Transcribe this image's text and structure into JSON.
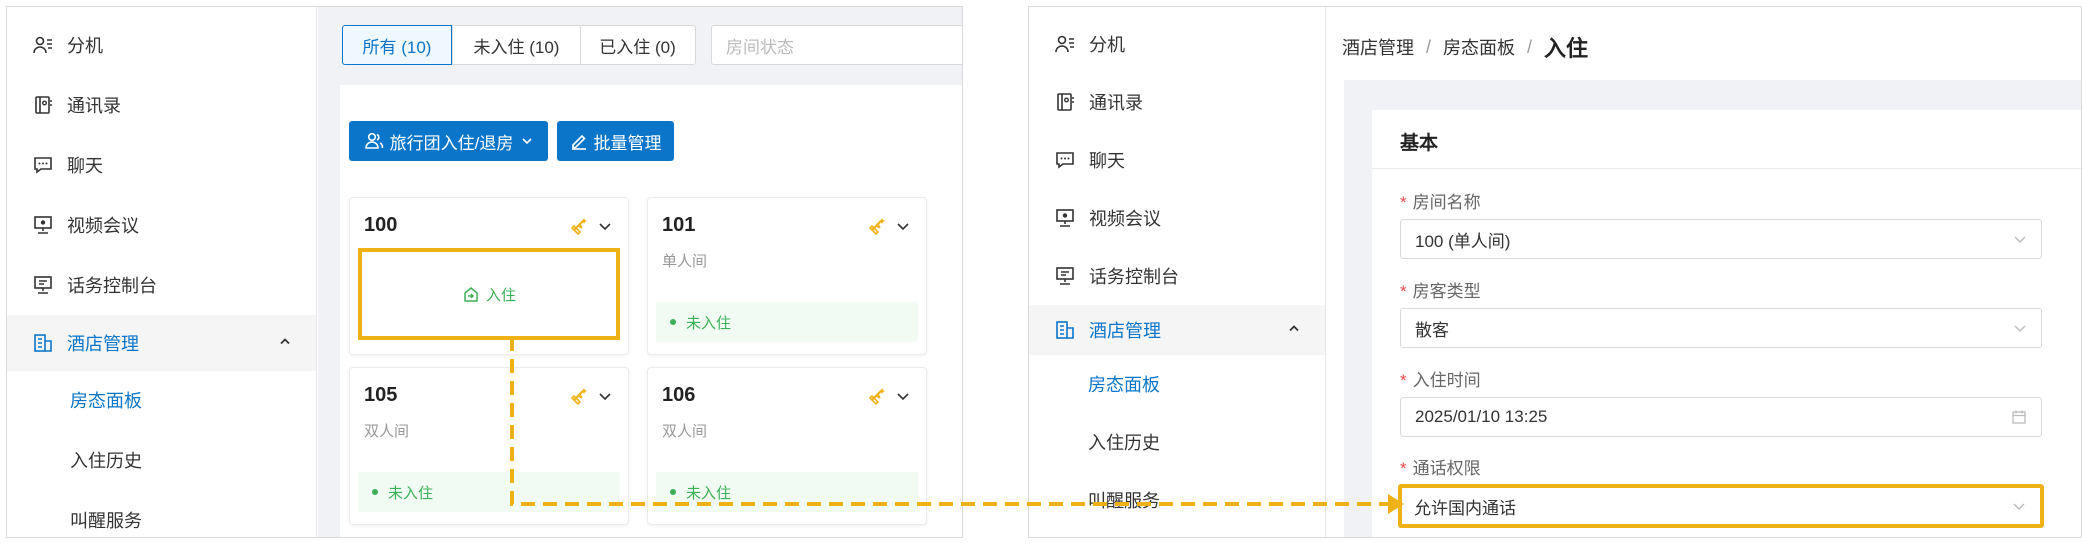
{
  "nav": {
    "items": [
      {
        "label": "分机",
        "icon": "extension-user-icon"
      },
      {
        "label": "通讯录",
        "icon": "contacts-icon"
      },
      {
        "label": "聊天",
        "icon": "chat-icon"
      },
      {
        "label": "视频会议",
        "icon": "video-conference-icon"
      },
      {
        "label": "话务控制台",
        "icon": "operator-console-icon"
      },
      {
        "label": "酒店管理",
        "icon": "hotel-icon"
      }
    ],
    "sub_items": [
      "房态面板",
      "入住历史",
      "叫醒服务"
    ]
  },
  "filters": {
    "tabs": [
      "所有 (10)",
      "未入住 (10)",
      "已入住 (0)"
    ],
    "status_placeholder": "房间状态"
  },
  "toolbar": {
    "group_label": "旅行团入住/退房",
    "batch_label": "批量管理"
  },
  "rooms": [
    {
      "number": "100",
      "type": "",
      "action": "入住"
    },
    {
      "number": "101",
      "type": "单人间",
      "status": "未入住"
    },
    {
      "number": "105",
      "type": "双人间",
      "status": "未入住"
    },
    {
      "number": "106",
      "type": "双人间",
      "status": "未入住"
    }
  ],
  "breadcrumb": {
    "level1": "酒店管理",
    "level2": "房态面板",
    "sep": "/",
    "current": "入住"
  },
  "form": {
    "section_title": "基本",
    "required_mark": "*",
    "fields": [
      {
        "label": "房间名称",
        "value": "100 (单人间)"
      },
      {
        "label": "房客类型",
        "value": "散客"
      },
      {
        "label": "入住时间",
        "value": "2025/01/10 13:25"
      },
      {
        "label": "通话权限",
        "value": "允许国内通话"
      }
    ]
  },
  "colors": {
    "primary": "#0b76c9",
    "highlight": "#efb215",
    "success": "#3bb058",
    "required": "#e5484d"
  }
}
